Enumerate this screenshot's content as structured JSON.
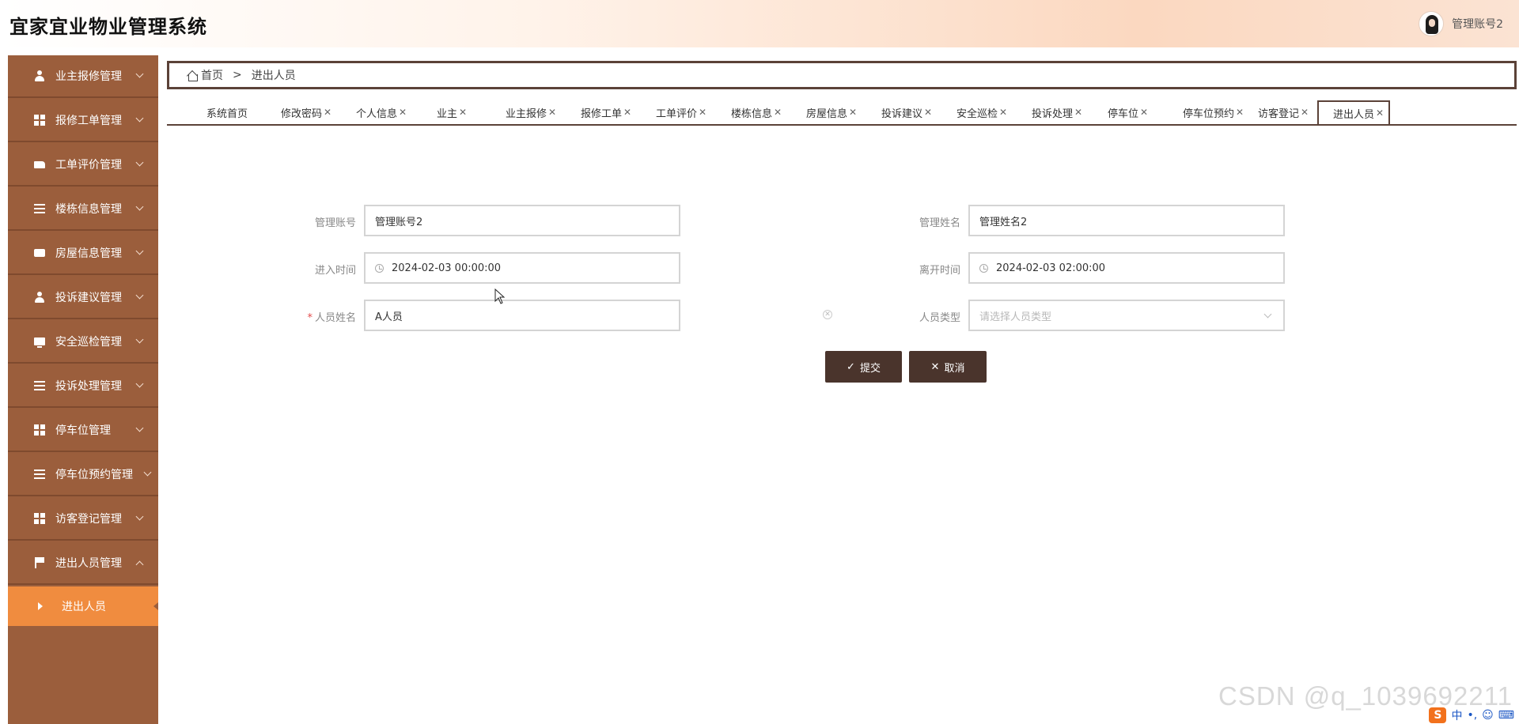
{
  "header": {
    "app_title": "宜家宜业物业管理系统",
    "user_name": "管理账号2"
  },
  "sidebar": {
    "items": [
      {
        "label": "业主报修管理",
        "icon": "user-icon"
      },
      {
        "label": "报修工单管理",
        "icon": "grid-icon"
      },
      {
        "label": "工单评价管理",
        "icon": "edit-icon"
      },
      {
        "label": "楼栋信息管理",
        "icon": "list-icon"
      },
      {
        "label": "房屋信息管理",
        "icon": "ticket-icon"
      },
      {
        "label": "投诉建议管理",
        "icon": "user-icon"
      },
      {
        "label": "安全巡检管理",
        "icon": "monitor-icon"
      },
      {
        "label": "投诉处理管理",
        "icon": "sliders-icon"
      },
      {
        "label": "停车位管理",
        "icon": "grid-icon"
      },
      {
        "label": "停车位预约管理",
        "icon": "list-icon"
      },
      {
        "label": "访客登记管理",
        "icon": "grid-icon"
      },
      {
        "label": "进出人员管理",
        "icon": "flag-icon"
      }
    ],
    "active_submenu": "进出人员"
  },
  "breadcrumb": {
    "home": "首页",
    "separator": ">",
    "current": "进出人员"
  },
  "tabs": [
    {
      "label": "系统首页",
      "closable": false
    },
    {
      "label": "修改密码",
      "closable": true
    },
    {
      "label": "个人信息",
      "closable": true
    },
    {
      "label": "业主",
      "closable": true
    },
    {
      "label": "业主报修",
      "closable": true
    },
    {
      "label": "报修工单",
      "closable": true
    },
    {
      "label": "工单评价",
      "closable": true
    },
    {
      "label": "楼栋信息",
      "closable": true
    },
    {
      "label": "房屋信息",
      "closable": true
    },
    {
      "label": "投诉建议",
      "closable": true
    },
    {
      "label": "安全巡检",
      "closable": true
    },
    {
      "label": "投诉处理",
      "closable": true
    },
    {
      "label": "停车位",
      "closable": true
    },
    {
      "label": "停车位预约",
      "closable": true
    },
    {
      "label": "访客登记",
      "closable": true
    },
    {
      "label": "进出人员",
      "closable": true,
      "active": true
    }
  ],
  "form": {
    "admin_account_label": "管理账号",
    "admin_account_value": "管理账号2",
    "admin_name_label": "管理姓名",
    "admin_name_value": "管理姓名2",
    "enter_time_label": "进入时间",
    "enter_time_value": "2024-02-03 00:00:00",
    "leave_time_label": "离开时间",
    "leave_time_value": "2024-02-03 02:00:00",
    "person_name_label": "人员姓名",
    "person_name_required": "*",
    "person_name_value": "A人员",
    "person_type_label": "人员类型",
    "person_type_placeholder": "请选择人员类型",
    "submit_label": "提交",
    "cancel_label": "取消"
  },
  "colors": {
    "sidebar_bg": "#9b5e3c",
    "sidebar_active": "#f08c3f",
    "button_bg": "#4a342c",
    "border_dark": "#5b4238"
  },
  "watermark": "CSDN @q_1039692211",
  "tray": {
    "ime_logo": "S",
    "ime_lang": "中",
    "ime_punct": "•,"
  }
}
